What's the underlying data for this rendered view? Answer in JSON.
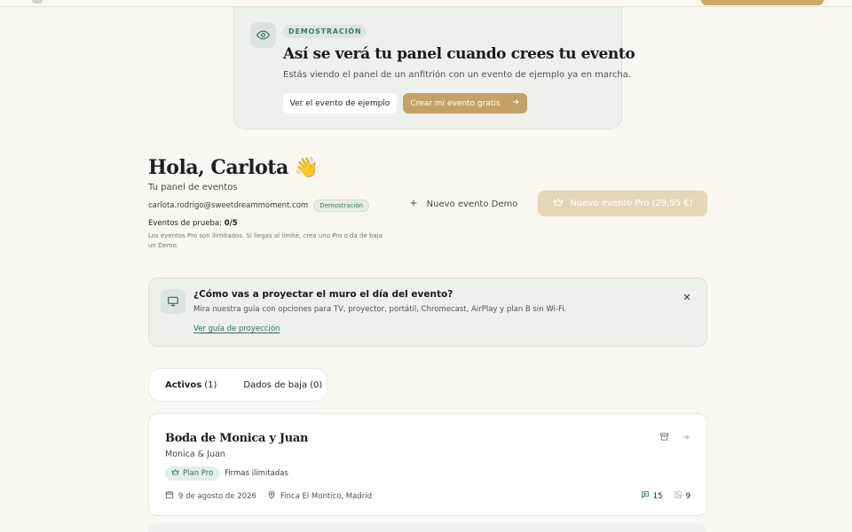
{
  "demo_banner": {
    "badge": "DEMOSTRACIÓN",
    "title": "Así se verá tu panel cuando crees tu evento",
    "description": "Estás viendo el panel de un anfitrión con un evento de ejemplo ya en marcha.",
    "view_example_label": "Ver el evento de ejemplo",
    "create_free_label": "Crear mi evento gratis"
  },
  "header": {
    "greeting": "Hola, Carlota 👋",
    "subtitle": "Tu panel de eventos",
    "email": "carlota.rodrigo@sweetdreammoment.com",
    "email_badge": "Demostración",
    "trial_label": "Eventos de prueba:",
    "trial_value": "0/5",
    "note": "Los eventos Pro son ilimitados. Si llegas al límite, crea uno Pro o da de baja un Demo.",
    "new_demo_label": "Nuevo evento Demo",
    "new_pro_label": "Nuevo evento Pro (29,95 €)"
  },
  "projection": {
    "title": "¿Cómo vas a proyectar el muro el día del evento?",
    "description": "Mira nuestra guía con opciones para TV, proyector, portátil, Chromecast, AirPlay y plan B sin Wi-Fi.",
    "link": "Ver guía de proyección"
  },
  "tabs": [
    {
      "label": "Activos",
      "count": "(1)"
    },
    {
      "label": "Dados de baja",
      "count": "(0)"
    }
  ],
  "event": {
    "title": "Boda de Monica y Juan",
    "couple": "Monica & Juan",
    "plan_badge": "Plan Pro",
    "plan_extra": "Firmas ilimitadas",
    "date": "9 de agosto de 2026",
    "location": "Finca El Montico, Madrid",
    "messages_count": "15",
    "photos_count": "9"
  },
  "colors": {
    "background": "#faf7f1",
    "accent_gold": "#c4a165",
    "accent_green": "#2f7a52"
  }
}
